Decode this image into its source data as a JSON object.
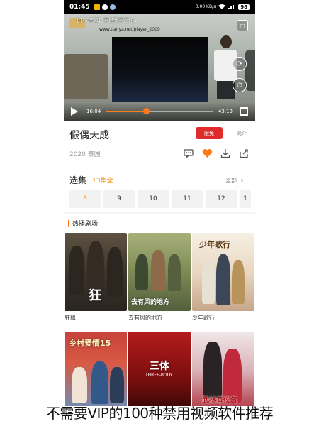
{
  "status_bar": {
    "time": "01:45",
    "network_speed": "0.00 KB/s",
    "battery": "98"
  },
  "video": {
    "top_title": "【中文字幕】不是我不爱你...",
    "overlay_url": "www.tianya.net/player_2009",
    "time_current": "16:04",
    "time_total": "43:13",
    "progress": 0.37
  },
  "show": {
    "title": "假偶天成",
    "meta": "2020 泰国",
    "vip_label": "限免",
    "intro_label": "简介"
  },
  "episodes": {
    "section_title": "选集",
    "count_text": "13集全",
    "all_label": "全部",
    "items": [
      "8",
      "9",
      "10",
      "11",
      "12",
      "1"
    ],
    "active_index": 0
  },
  "hot": {
    "section_title": "热播剧场",
    "items": [
      {
        "title": "狂飙",
        "poster_text": "狂"
      },
      {
        "title": "去有风的地方",
        "poster_text": "去有风的地方"
      },
      {
        "title": "少年歌行",
        "poster_text": "少年歌行"
      },
      {
        "title": "",
        "poster_text": "乡村爱情15"
      },
      {
        "title": "",
        "poster_text": "三体"
      },
      {
        "title": "",
        "poster_text": "武林有侠气"
      }
    ]
  },
  "caption": "不需要VIP的100种禁用视频软件推荐",
  "colors": {
    "accent": "#ff8a00",
    "vip_red": "#e02b2b"
  }
}
